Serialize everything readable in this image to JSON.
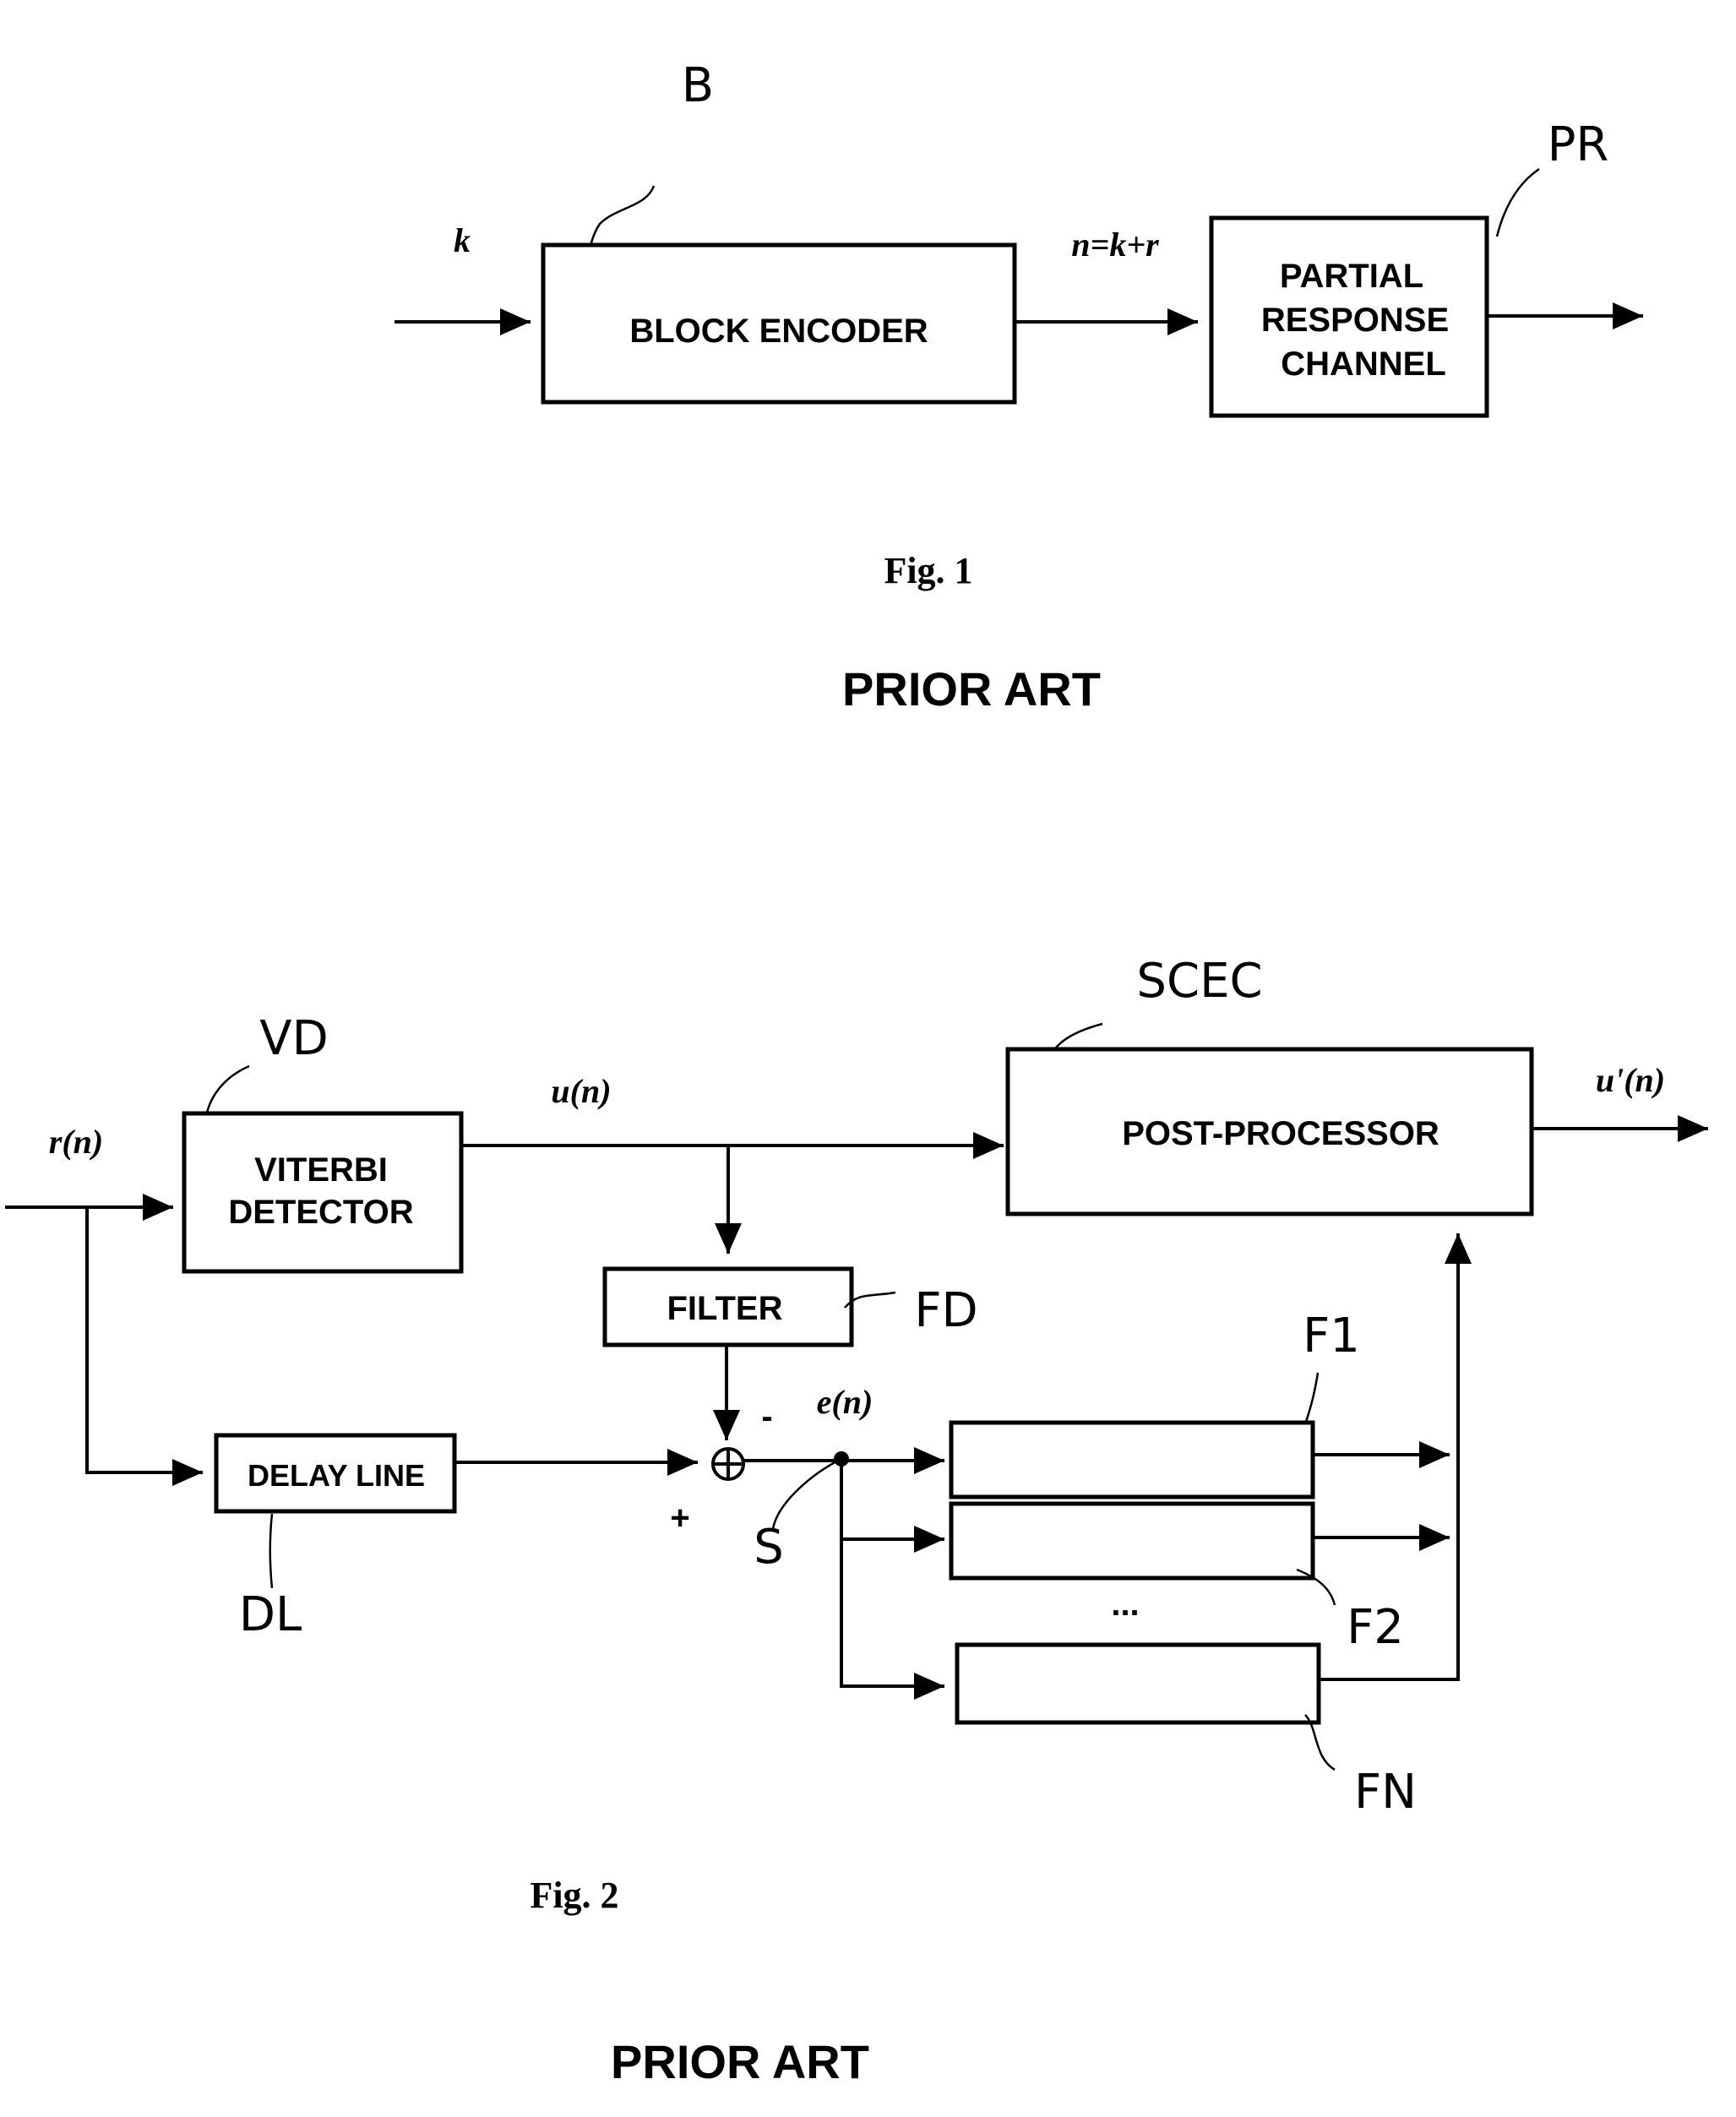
{
  "fig1": {
    "caption": "Fig. 1",
    "prior_art": "PRIOR ART",
    "input_label": "k",
    "mid_label": "n=k+r",
    "block_encoder": {
      "ref": "B",
      "lines": [
        "BLOCK ENCODER"
      ]
    },
    "pr_channel": {
      "ref": "PR",
      "lines": [
        "PARTIAL",
        "RESPONSE",
        "CHANNEL"
      ]
    }
  },
  "fig2": {
    "caption": "Fig. 2",
    "prior_art": "PRIOR ART",
    "input_label": "r(n)",
    "un_label": "u(n)",
    "output_label": "u'(n)",
    "en_label": "e(n)",
    "minus_sign": "-",
    "plus_sign": "+",
    "dots": "...",
    "viterbi": {
      "ref": "VD",
      "lines": [
        "VITERBI",
        "DETECTOR"
      ]
    },
    "post_processor": {
      "ref": "SCEC",
      "lines": [
        "POST-PROCESSOR"
      ]
    },
    "filter": {
      "ref": "FD",
      "lines": [
        "FILTER"
      ]
    },
    "delay_line": {
      "ref": "DL",
      "lines": [
        "DELAY LINE"
      ]
    },
    "summing_node_ref": "S",
    "filters": [
      {
        "ref": "F1"
      },
      {
        "ref": "F2"
      },
      {
        "ref": "FN"
      }
    ]
  }
}
